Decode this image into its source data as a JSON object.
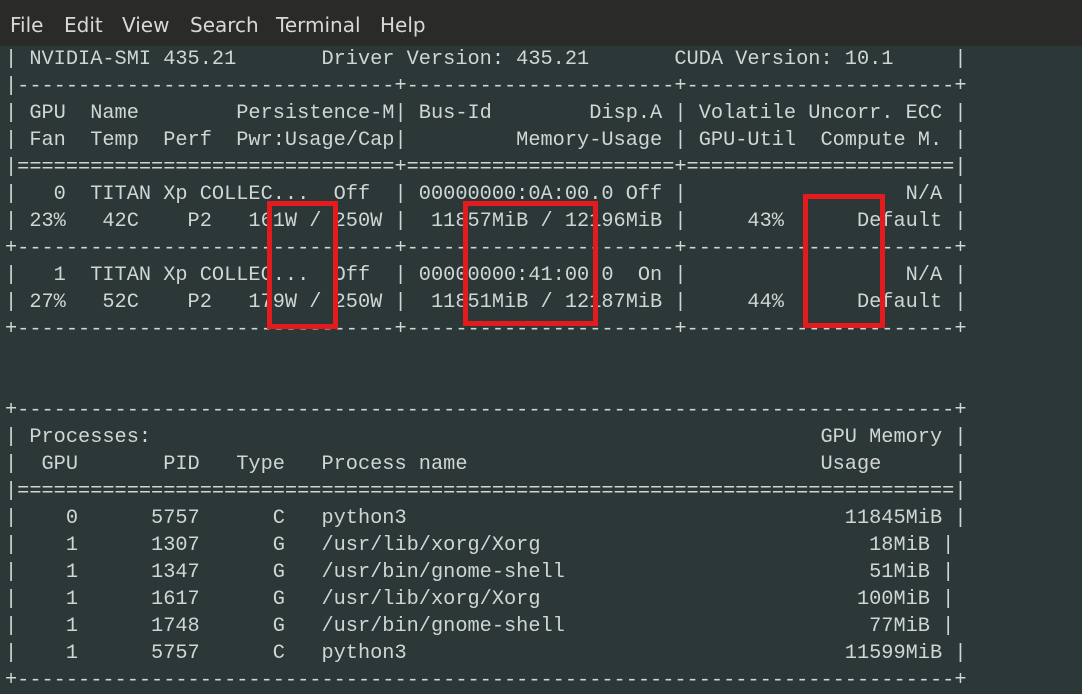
{
  "menu": {
    "items": [
      "File",
      "Edit",
      "View",
      "Search",
      "Terminal",
      "Help"
    ]
  },
  "terminal": {
    "lines": [
      "| NVIDIA-SMI 435.21       Driver Version: 435.21       CUDA Version: 10.1     |",
      "|-------------------------------+----------------------+----------------------+",
      "| GPU  Name        Persistence-M| Bus-Id        Disp.A | Volatile Uncorr. ECC |",
      "| Fan  Temp  Perf  Pwr:Usage/Cap|         Memory-Usage | GPU-Util  Compute M. |",
      "|===============================+======================+======================|",
      "|   0  TITAN Xp COLLEC...  Off  | 00000000:0A:00.0 Off |                  N/A |",
      "| 23%   42C    P2   161W / 250W |  11857MiB / 12196MiB |     43%      Default |",
      "+-------------------------------+----------------------+----------------------+",
      "|   1  TITAN Xp COLLEC...  Off  | 00000000:41:00.0  On |                  N/A |",
      "| 27%   52C    P2   179W / 250W |  11851MiB / 12187MiB |     44%      Default |",
      "+-------------------------------+----------------------+----------------------+",
      "",
      "",
      "+-----------------------------------------------------------------------------+",
      "| Processes:                                                       GPU Memory |",
      "|  GPU       PID   Type   Process name                             Usage      |",
      "|=============================================================================|",
      "|    0      5757      C   python3                                    11845MiB |",
      "|    1      1307      G   /usr/lib/xorg/Xorg                           18MiB |",
      "|    1      1347      G   /usr/bin/gnome-shell                         51MiB |",
      "|    1      1617      G   /usr/lib/xorg/Xorg                          100MiB |",
      "|    1      1748      G   /usr/bin/gnome-shell                         77MiB |",
      "|    1      5757      C   python3                                    11599MiB |",
      "+-----------------------------------------------------------------------------+"
    ]
  },
  "colors": {
    "background": "#2c3738",
    "text": "#cfd6d4",
    "menubar": "#2a2a28",
    "highlight": "#e31b1d"
  }
}
